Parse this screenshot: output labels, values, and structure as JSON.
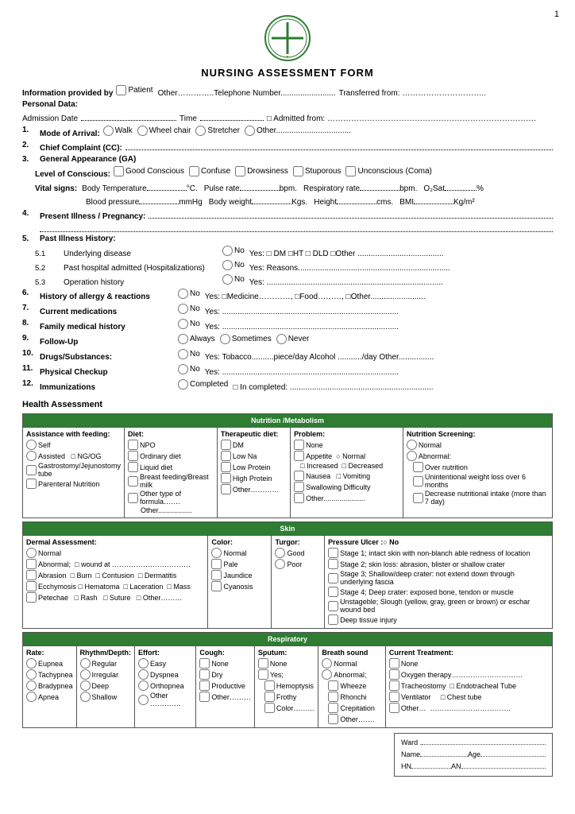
{
  "page": {
    "number": "1",
    "title": "NURSING ASSESSMENT FORM"
  },
  "header": {
    "info_provided_by": "Information provided by",
    "patient_label": "Patient",
    "other_label": "Other…………..Telephone Number.........................",
    "transferred_label": "Transferred from: …………………………..",
    "personal_data": "Personal Data:",
    "admission_date": "Admission Date",
    "time": "Time",
    "admitted_from": "Admitted from: ………………………………………………………………….."
  },
  "items": [
    {
      "num": "1.",
      "label": "Mode of Arrival:",
      "options": [
        "Walk",
        "Wheel chair",
        "Stretcher",
        "Other...................................."
      ]
    },
    {
      "num": "2.",
      "label": "Chief Complaint (CC):",
      "line": true
    },
    {
      "num": "3.",
      "label": "General Appearance (GA)"
    }
  ],
  "level_of_conscious": {
    "label": "Level of Conscious:",
    "options": [
      "Good Conscious",
      "Confuse",
      "Drowsiness",
      "Stuporous",
      "Unconscious (Coma)"
    ]
  },
  "vital_signs": {
    "label": "Vital signs:",
    "items": [
      "Body Temperature..............°C.",
      "Pulse rate..................bpm.",
      "Respiratory rate..............bpm.",
      "O₂Sat..........%",
      "Blood pressure..............mmHg",
      "Body weight..............Kgs.",
      "Height..............cms.",
      "BMI................. Kg/m²"
    ]
  },
  "numbered_items": [
    {
      "num": "4.",
      "label": "Present Illness / Pregnancy:",
      "lines": 2
    },
    {
      "num": "5.",
      "label": "Past Illness History:",
      "subitems": [
        {
          "num": "5.1",
          "label": "Underlying disease",
          "radio": "No",
          "yes_options": "Yes: □ DM □HT □ DLD □Other ......................................."
        },
        {
          "num": "5.2",
          "label": "Past hospital admitted (Hospitalizations)",
          "radio": "No",
          "yes_options": "Yes: Reasons....................................................................."
        },
        {
          "num": "5.3",
          "label": "Operation history",
          "radio": "No",
          "yes_options": "Yes: ................................................................................"
        }
      ]
    },
    {
      "num": "6.",
      "label": "History of allergy & reactions",
      "radio": "No",
      "yes_options": "Yes: □Medicine…………, □Food………, □Other........................."
    },
    {
      "num": "7.",
      "label": "Current medications",
      "radio": "No",
      "yes_options": "Yes: ................................................................................"
    },
    {
      "num": "8.",
      "label": "Family medical history",
      "radio": "No",
      "yes_options": "Yes: ................................................................................"
    },
    {
      "num": "9.",
      "label": "Follow-Up",
      "radio": "Always",
      "options": [
        "Sometimes",
        "Never"
      ]
    },
    {
      "num": "10.",
      "label": "Drugs/Substances:",
      "radio": "No",
      "yes_options": "Yes: Tobacco..........piece/day  Alcohol .........../day  Other................"
    },
    {
      "num": "11.",
      "label": "Physical Checkup",
      "radio": "No",
      "yes_options": "Yes: ................................................................................"
    },
    {
      "num": "12.",
      "label": "Immunizations",
      "radio": "Completed",
      "yes_options": "□ In completed: ................................................................."
    }
  ],
  "health_assessment": {
    "title": "Health Assessment",
    "sections": {
      "nutrition": {
        "header": "Nutrition /Metabolism",
        "columns": {
          "assistance": {
            "title": "Assistance with feeding:",
            "items": [
              "Self",
              "Assisted",
              "NG/OG",
              "Gastrostomy/Jejunostomy tube",
              "Parenteral Nutrition"
            ]
          },
          "diet": {
            "title": "Diet:",
            "items": [
              "NPO",
              "Ordinary diet",
              "Liquid diet",
              "Breast feeding/Breast milk",
              "Other type of formula…….",
              "Other................."
            ]
          },
          "therapeutic": {
            "title": "Therapeutic diet:",
            "items": [
              "DM",
              "Low Na",
              "Low Protein",
              "High Protein",
              "Other…………"
            ]
          },
          "problem": {
            "title": "Problem:",
            "items": [
              "None",
              "Appetite  ○ Normal",
              "□ Increased  □ Decreased",
              "Nausea    □ Vomiting",
              "Swallowing Difficulty",
              "Other....................."
            ]
          },
          "screening": {
            "title": "Nutrition Screening:",
            "items": [
              "Normal",
              "Abnormal:",
              "□ Over nutrition",
              "□ Unintentional weight loss over 6 months",
              "□ Decrease nutritional intake (more than 7 day)"
            ]
          }
        }
      },
      "skin": {
        "header": "Skin",
        "columns": {
          "dermal": {
            "title": "Dermal Assessment:",
            "items": [
              "Normal",
              "Abnormal;  □ wound at ……………………………",
              "□ Abrasion  □ Burn  □ Contusion  □ Dermatitis",
              "□ Ecchymosis □ Hematoma  □ Laceration  □ Mass",
              "□ Petechae   □ Rash   □ Suture   □ Other………"
            ]
          },
          "color": {
            "title": "Color:",
            "items": [
              "Normal",
              "Pale",
              "Jaundice",
              "Cyanosis"
            ]
          },
          "turgor": {
            "title": "Turgor:",
            "items": [
              "Good",
              "Poor"
            ]
          },
          "pressure_ulcer": {
            "title": "Pressure Ulcer :○ No",
            "items": [
              "□ Stage 1; intact skin with non-blanch able redness of  location",
              "□ Stage 2; skin loss: abrasion, blister or shallow crater",
              "□ Stage 3; Shallow/deep crater: not extend down through underlying fascia",
              "□ Stage 4; Deep crater: exposed bone, tendon or muscle",
              "□ Unstageble; Slough (yellow, gray, green or brown) or eschar wound bed",
              "□ Deep tissue injury"
            ]
          }
        }
      },
      "respiratory": {
        "header": "Respiratory",
        "columns": {
          "rate": {
            "title": "Rate:",
            "items": [
              "Eupnea",
              "Tachypnea",
              "Bradypnea",
              "Apnea"
            ]
          },
          "rhythm": {
            "title": "Rhythm/Depth:",
            "items": [
              "Regular",
              "Irregular",
              "Deep",
              "Shallow"
            ]
          },
          "effort": {
            "title": "Effort:",
            "items": [
              "Easy",
              "Dyspnea",
              "Orthopnea",
              "Other …………."
            ]
          },
          "cough": {
            "title": "Cough:",
            "items": [
              "None",
              "Dry",
              "Productive",
              "Other………"
            ]
          },
          "sputum": {
            "title": "Sputum:",
            "items": [
              "None",
              "Yes;",
              "□ Hemoptysis",
              "□ Frothy",
              "□ Color………"
            ]
          },
          "breath_sound": {
            "title": "Breath sound",
            "items": [
              "Normal",
              "Abnormal;",
              "□ Wheeze",
              "□ Rhonchi",
              "□ Crepitation",
              "□ Other…….."
            ]
          },
          "current_treatment": {
            "title": "Current Treatment:",
            "items": [
              "None",
              "Oxygen therapy…………………………",
              "Tracheostomy  □ Endotracheal Tube",
              "Ventilator      □ Chest tube",
              "Other…  …………………………….."
            ]
          }
        }
      }
    }
  },
  "ward_box": {
    "ward_label": "Ward .",
    "name_label": "Name",
    "age_label": "Age",
    "hn_label": "HN",
    "an_label": "AN"
  },
  "nutrition_screening": {
    "normal_label": "0 Normal"
  }
}
